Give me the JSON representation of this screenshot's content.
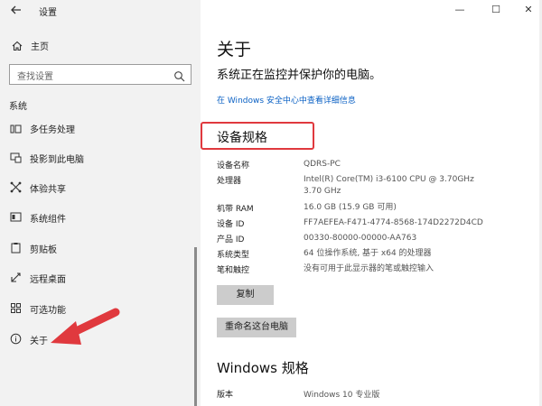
{
  "window": {
    "title": "设置",
    "back_icon": "back-arrow-icon",
    "controls": {
      "minimize": "—",
      "maximize": "☐",
      "close": "✕"
    }
  },
  "sidebar": {
    "home_label": "主页",
    "search_placeholder": "查找设置",
    "section_label": "系统",
    "items": [
      {
        "label": "多任务处理",
        "icon": "multitask-icon"
      },
      {
        "label": "投影到此电脑",
        "icon": "project-icon"
      },
      {
        "label": "体验共享",
        "icon": "share-icon"
      },
      {
        "label": "系统组件",
        "icon": "components-icon"
      },
      {
        "label": "剪贴板",
        "icon": "clipboard-icon"
      },
      {
        "label": "远程桌面",
        "icon": "remote-desktop-icon"
      },
      {
        "label": "可选功能",
        "icon": "optional-features-icon"
      },
      {
        "label": "关于",
        "icon": "info-icon"
      }
    ]
  },
  "main": {
    "title": "关于",
    "protect_text": "系统正在监控并保护你的电脑。",
    "security_link": "在 Windows 安全中心中查看详细信息",
    "device_specs_title": "设备规格",
    "specs": [
      {
        "key": "设备名称",
        "value": "QDRS-PC"
      },
      {
        "key": "处理器",
        "value": "Intel(R) Core(TM) i3-6100 CPU @ 3.70GHz   3.70 GHz"
      },
      {
        "key": "机带 RAM",
        "value": "16.0 GB (15.9 GB 可用)"
      },
      {
        "key": "设备 ID",
        "value": "FF7AEFEA-F471-4774-8568-174D2272D4CD"
      },
      {
        "key": "产品 ID",
        "value": "00330-80000-00000-AA763"
      },
      {
        "key": "系统类型",
        "value": "64 位操作系统, 基于 x64 的处理器"
      },
      {
        "key": "笔和触控",
        "value": "没有可用于此显示器的笔或触控输入"
      }
    ],
    "copy_button": "复制",
    "rename_button": "重命名这台电脑",
    "windows_specs_title": "Windows 规格",
    "windows_specs": [
      {
        "key": "版本",
        "value": "Windows 10 专业版"
      }
    ]
  },
  "colors": {
    "sidebar_bg": "#f2f2f2",
    "link": "#0b61c4",
    "highlight": "#e0393e",
    "button_bg": "#cccccc"
  }
}
